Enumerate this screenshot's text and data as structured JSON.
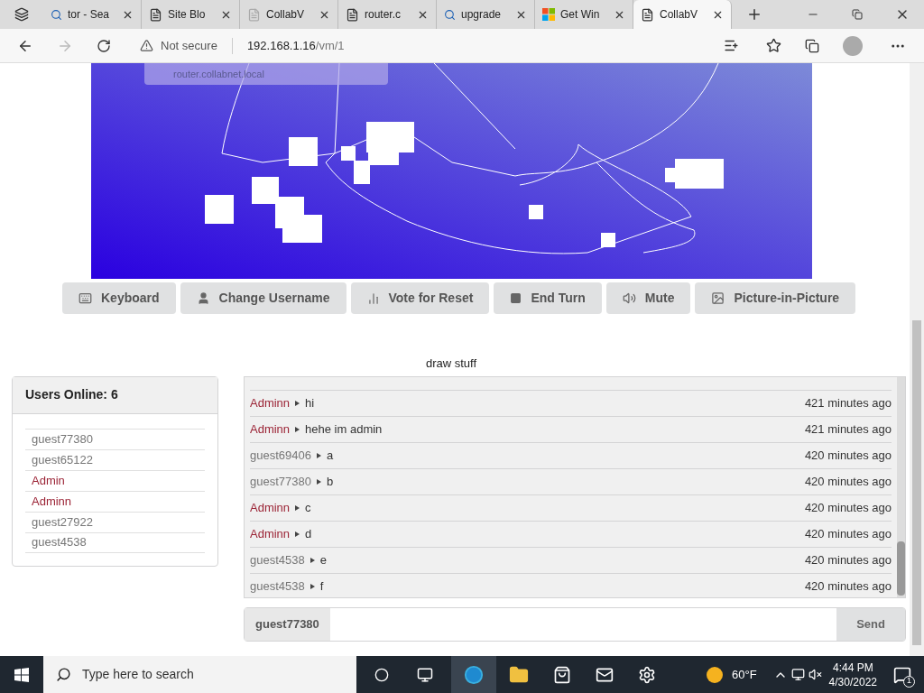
{
  "browser": {
    "tabs": [
      {
        "label": "tor - Sea",
        "kind": "search",
        "selected": false
      },
      {
        "label": "Site Blo",
        "kind": "page",
        "selected": false
      },
      {
        "label": "CollabV",
        "kind": "faded",
        "selected": false
      },
      {
        "label": "router.c",
        "kind": "page",
        "selected": false
      },
      {
        "label": "upgrade",
        "kind": "search",
        "selected": false
      },
      {
        "label": "Get Win",
        "kind": "store",
        "selected": false
      },
      {
        "label": "CollabV",
        "kind": "page",
        "selected": true
      }
    ],
    "security": "Not secure",
    "url_host": "192.168.1.16",
    "url_path": "/vm/1",
    "tooltip": {
      "url": "router.collabnet.local"
    }
  },
  "toolbar": [
    {
      "label": "Keyboard"
    },
    {
      "label": "Change Username"
    },
    {
      "label": "Vote for Reset"
    },
    {
      "label": "End Turn"
    },
    {
      "label": "Mute"
    },
    {
      "label": "Picture-in-Picture"
    }
  ],
  "vm_title": "draw stuff",
  "users": {
    "title": "Users Online: 6",
    "items": [
      {
        "name": "guest77380",
        "color": "#767676"
      },
      {
        "name": "guest65122",
        "color": "#767676"
      },
      {
        "name": "Admin",
        "color": "#9b2335"
      },
      {
        "name": "Adminn",
        "color": "#9b2335"
      },
      {
        "name": "guest27922",
        "color": "#767676"
      },
      {
        "name": "guest4538",
        "color": "#767676"
      }
    ]
  },
  "chat": [
    {
      "user": "Adminn",
      "color": "#9b2335",
      "message": "hi",
      "time": "421 minutes ago"
    },
    {
      "user": "Adminn",
      "color": "#9b2335",
      "message": "hehe im admin",
      "time": "421 minutes ago"
    },
    {
      "user": "guest69406",
      "color": "#767676",
      "message": "a",
      "time": "420 minutes ago"
    },
    {
      "user": "guest77380",
      "color": "#767676",
      "message": "b",
      "time": "420 minutes ago"
    },
    {
      "user": "Adminn",
      "color": "#9b2335",
      "message": "c",
      "time": "420 minutes ago"
    },
    {
      "user": "Adminn",
      "color": "#9b2335",
      "message": "d",
      "time": "420 minutes ago"
    },
    {
      "user": "guest4538",
      "color": "#767676",
      "message": "e",
      "time": "420 minutes ago"
    },
    {
      "user": "guest4538",
      "color": "#767676",
      "message": "f",
      "time": "420 minutes ago"
    }
  ],
  "chat_input": {
    "username": "guest77380",
    "send": "Send"
  },
  "taskbar": {
    "search_placeholder": "Type here to search",
    "weather": "60°F",
    "time": "4:44 PM",
    "date": "4/30/2022",
    "notifications": "1"
  }
}
